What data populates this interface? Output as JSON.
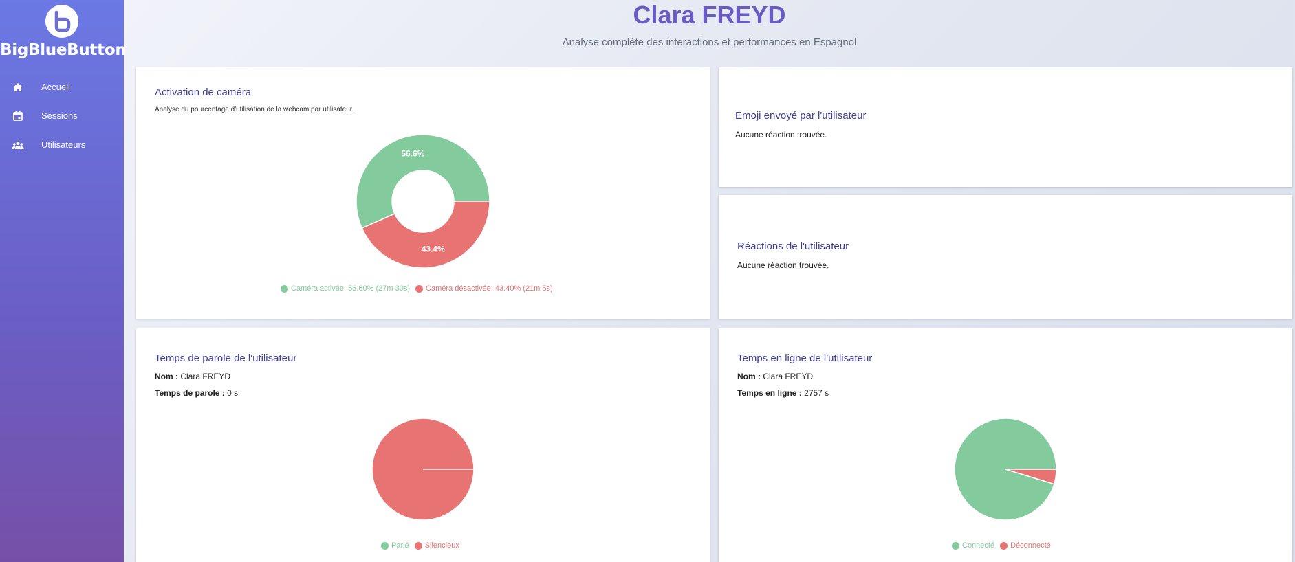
{
  "sidebar": {
    "logo_text": "BigBlueButton",
    "items": [
      {
        "label": "Accueil",
        "icon": "home-icon"
      },
      {
        "label": "Sessions",
        "icon": "calendar-icon"
      },
      {
        "label": "Utilisateurs",
        "icon": "users-icon"
      }
    ]
  },
  "header": {
    "title": "Clara FREYD",
    "subtitle": "Analyse complète des interactions et performances en Espagnol"
  },
  "camera_card": {
    "title": "Activation de caméra",
    "description": "Analyse du pourcentage d'utilisation de la webcam par utilisateur.",
    "legend": [
      {
        "label": "Caméra activée: 56.60% (27m 30s)",
        "color": "#83cb9d"
      },
      {
        "label": "Caméra désactivée: 43.40% (21m 5s)",
        "color": "#e77373"
      }
    ]
  },
  "emoji_card": {
    "title": "Emoji envoyé par l'utilisateur",
    "text": "Aucune réaction trouvée."
  },
  "reactions_card": {
    "title": "Réactions de l'utilisateur",
    "text": "Aucune réaction trouvée."
  },
  "speaking_card": {
    "title": "Temps de parole de l'utilisateur",
    "name_label": "Nom :",
    "name_value": "Clara FREYD",
    "time_label": "Temps de parole :",
    "time_value": "0 s",
    "legend": [
      {
        "label": "Parlé",
        "color": "#83cb9d"
      },
      {
        "label": "Silencieux",
        "color": "#e77373"
      }
    ]
  },
  "online_card": {
    "title": "Temps en ligne de l'utilisateur",
    "name_label": "Nom :",
    "name_value": "Clara FREYD",
    "time_label": "Temps en ligne :",
    "time_value": "2757 s",
    "legend": [
      {
        "label": "Connecté",
        "color": "#83cb9d"
      },
      {
        "label": "Déconnecté",
        "color": "#e77373"
      }
    ]
  },
  "chart_data": [
    {
      "type": "pie",
      "variant": "doughnut",
      "title": "Activation de caméra",
      "categories": [
        "Caméra activée",
        "Caméra désactivée"
      ],
      "values": [
        56.6,
        43.4
      ],
      "data_labels": [
        "56.6%",
        "43.4%"
      ],
      "colors": [
        "#83cb9d",
        "#e77373"
      ],
      "legend": "bottom"
    },
    {
      "type": "pie",
      "title": "Temps de parole de l'utilisateur",
      "categories": [
        "Parlé",
        "Silencieux"
      ],
      "values": [
        0,
        100
      ],
      "colors": [
        "#83cb9d",
        "#e77373"
      ],
      "legend": "bottom"
    },
    {
      "type": "pie",
      "title": "Temps en ligne de l'utilisateur",
      "categories": [
        "Connecté",
        "Déconnecté"
      ],
      "values": [
        95.3,
        4.7
      ],
      "colors": [
        "#83cb9d",
        "#e77373"
      ],
      "legend": "bottom"
    }
  ]
}
